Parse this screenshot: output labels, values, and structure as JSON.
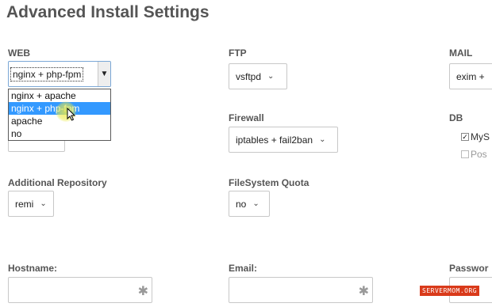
{
  "page": {
    "title": "Advanced Install Settings"
  },
  "web": {
    "label": "WEB",
    "value": "nginx + php-fpm",
    "options": [
      {
        "label": "nginx + apache",
        "selected": false
      },
      {
        "label": "nginx + php-fpm",
        "selected": true
      },
      {
        "label": "apache",
        "selected": false
      },
      {
        "label": "no",
        "selected": false
      }
    ]
  },
  "ftp": {
    "label": "FTP",
    "value": "vsftpd"
  },
  "mail": {
    "label": "MAIL",
    "value": "exim +"
  },
  "firewall": {
    "label": "Firewall",
    "value": "iptables + fail2ban"
  },
  "db": {
    "label": "DB",
    "options": [
      {
        "label": "MyS",
        "checked": true
      },
      {
        "label": "Pos",
        "checked": false
      }
    ]
  },
  "repo": {
    "label": "Additional Repository",
    "value": "remi"
  },
  "quota": {
    "label": "FileSystem Quota",
    "value": "no"
  },
  "hostname": {
    "label": "Hostname:",
    "value": ""
  },
  "email": {
    "label": "Email:",
    "value": ""
  },
  "password": {
    "label": "Passwor",
    "value": ""
  },
  "watermark": {
    "text": "SERVERMOM.ORG"
  },
  "icons": {
    "caret": "chevron-down-icon",
    "required": "asterisk-icon",
    "check": "checkmark-icon"
  },
  "colors": {
    "selection": "#3399ff",
    "watermark": "#d93a1a",
    "label": "#555555"
  }
}
